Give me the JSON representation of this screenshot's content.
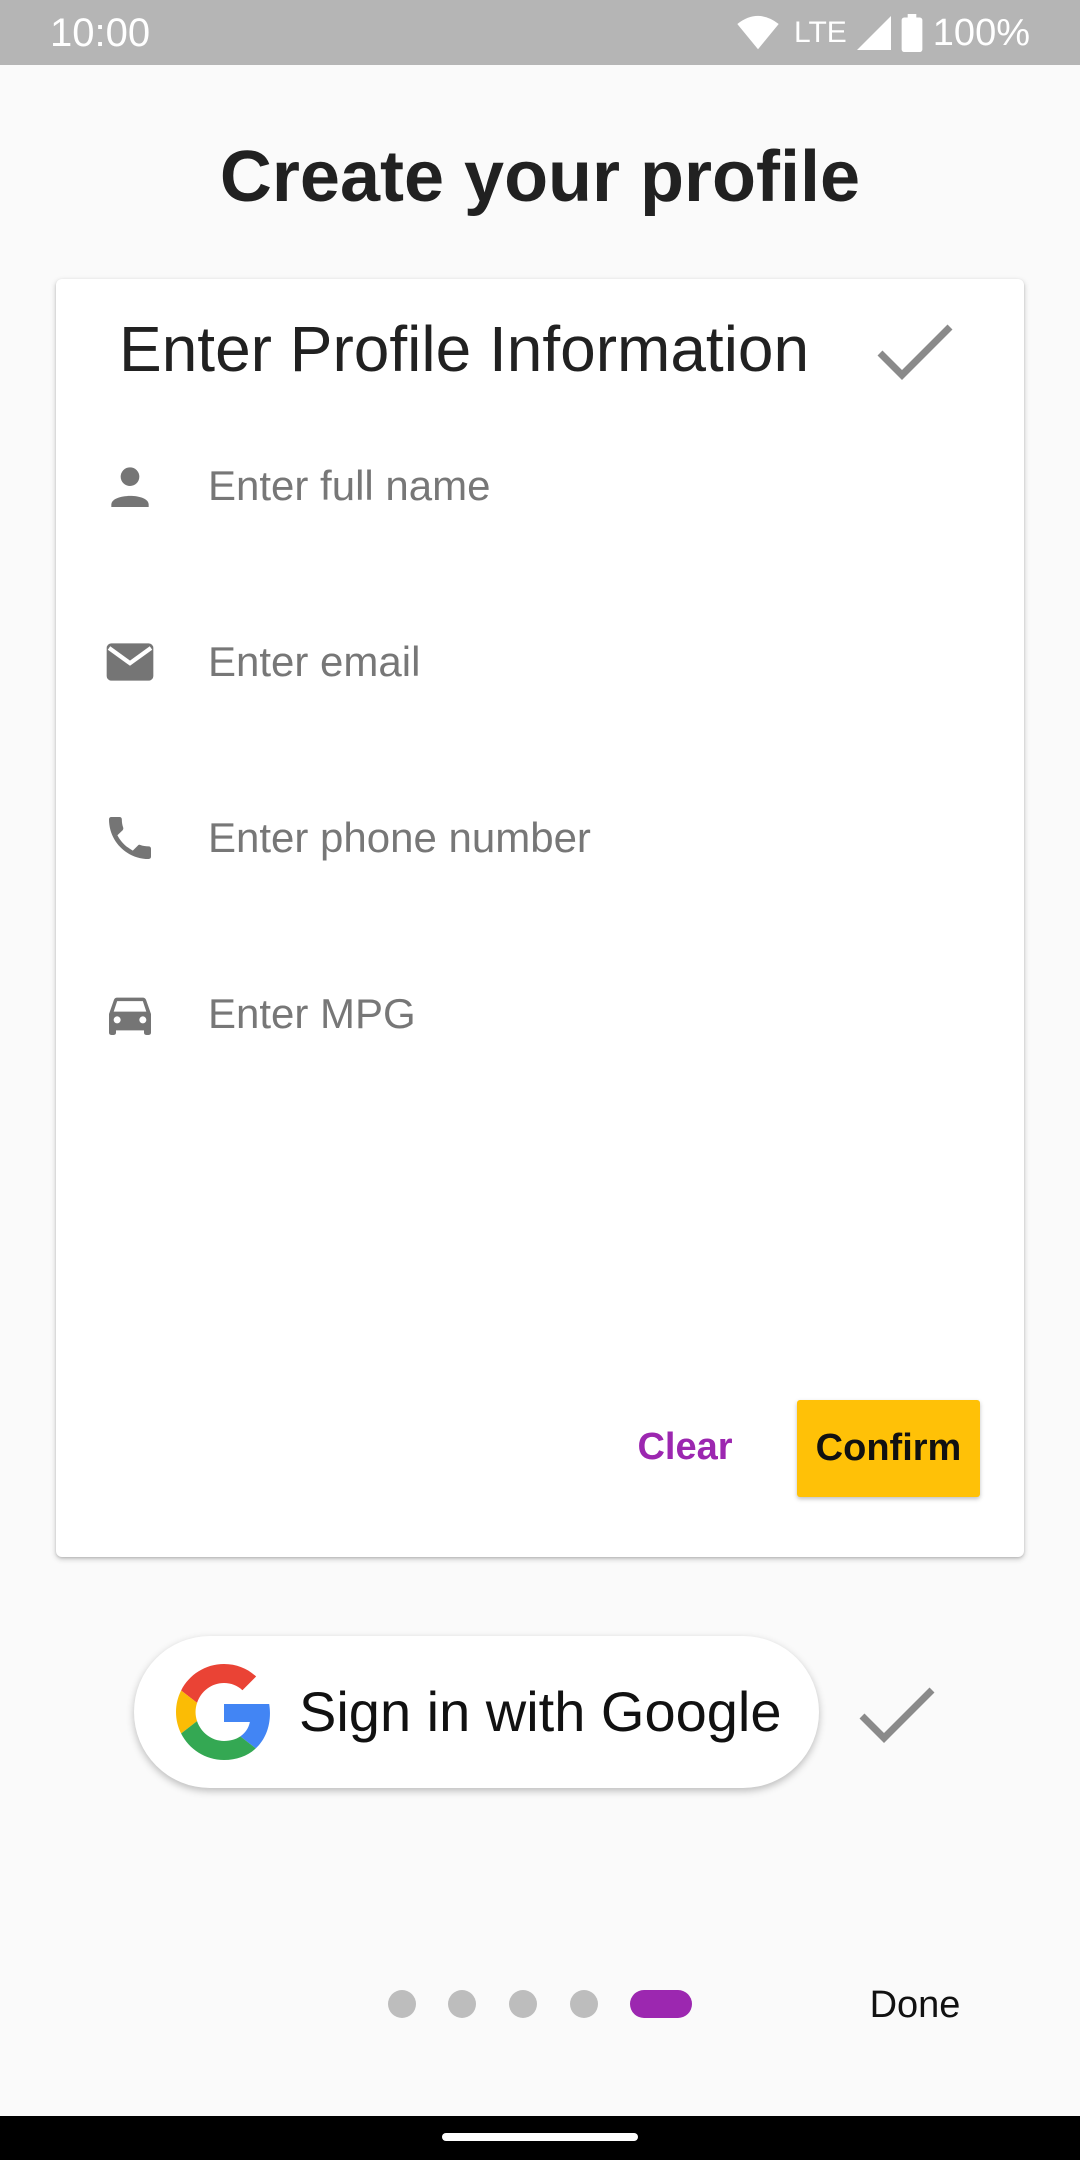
{
  "status_bar": {
    "time": "10:00",
    "network": "LTE",
    "battery": "100%"
  },
  "page": {
    "title": "Create your profile"
  },
  "profile_card": {
    "title": "Enter Profile Information",
    "fields": [
      {
        "icon": "person-icon",
        "placeholder": "Enter full name",
        "value": ""
      },
      {
        "icon": "email-icon",
        "placeholder": "Enter email",
        "value": ""
      },
      {
        "icon": "phone-icon",
        "placeholder": "Enter phone number",
        "value": ""
      },
      {
        "icon": "car-icon",
        "placeholder": "Enter MPG",
        "value": ""
      }
    ],
    "clear_label": "Clear",
    "confirm_label": "Confirm"
  },
  "google_signin": {
    "label": "Sign in with Google"
  },
  "pager": {
    "page_count": 5,
    "current_page": 5
  },
  "footer": {
    "done_label": "Done"
  },
  "colors": {
    "accent_purple": "#9c27b0",
    "confirm_yellow": "#ffc107",
    "status_bar_gray": "#b5b5b5",
    "icon_gray": "#757575",
    "check_gray": "#8a8a8a"
  }
}
